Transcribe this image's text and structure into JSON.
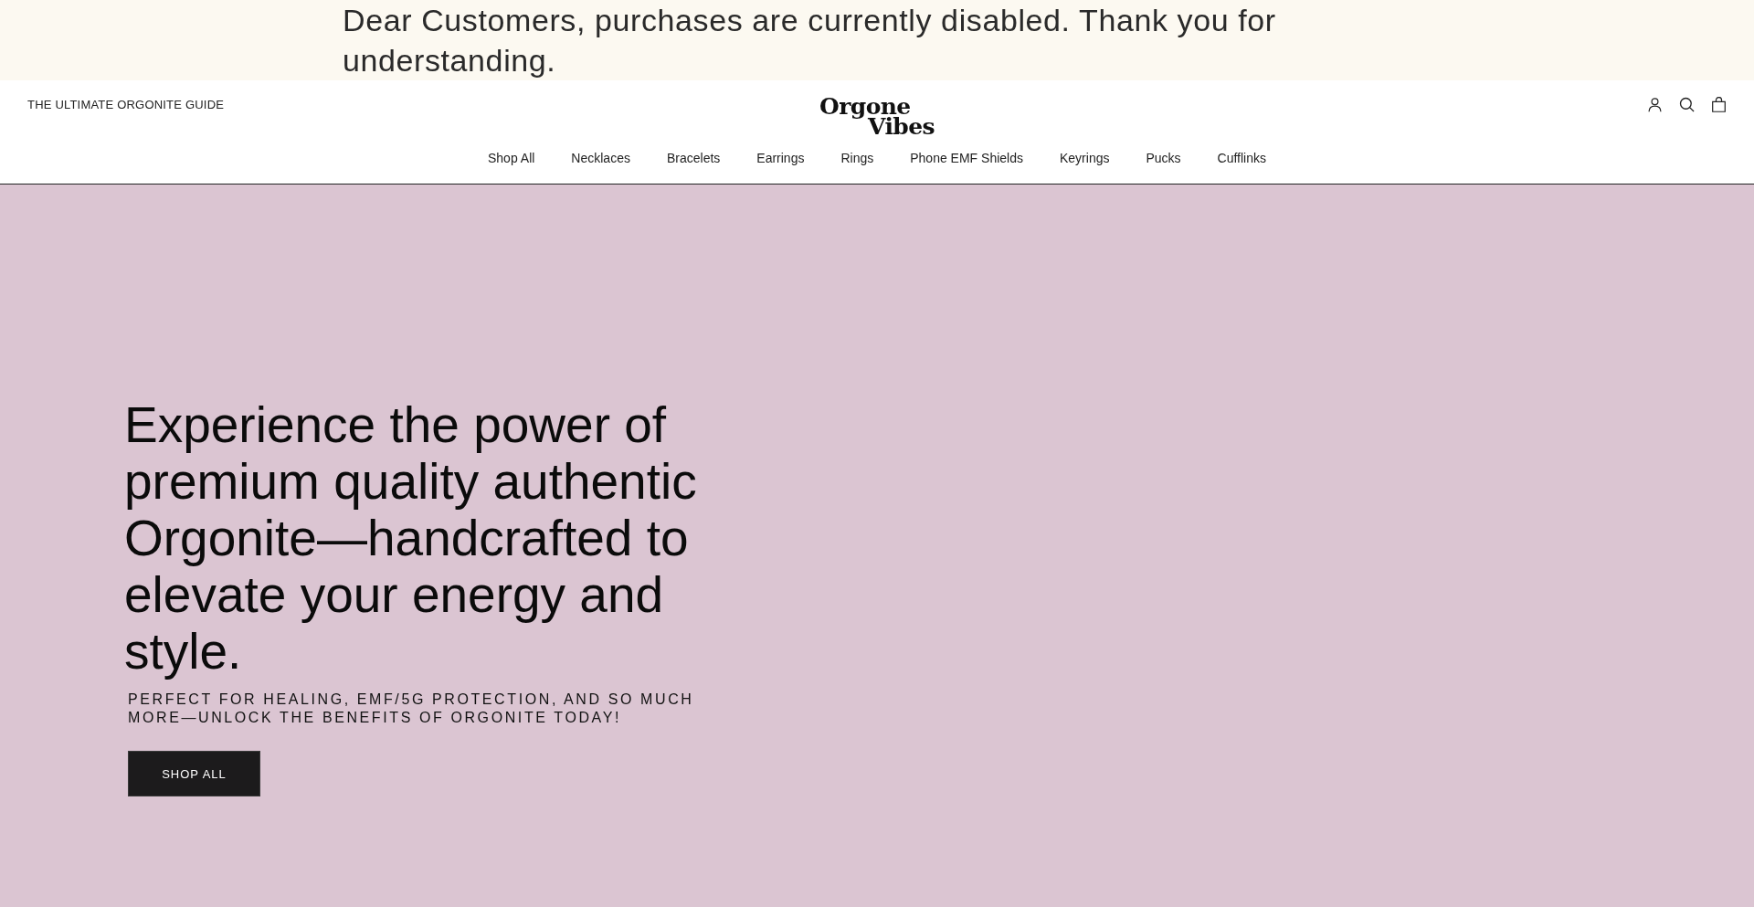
{
  "announcement": {
    "text": "Dear Customers, purchases are currently disabled. Thank you for understanding."
  },
  "header": {
    "guide_link": "THE ULTIMATE ORGONITE GUIDE",
    "logo_lines": [
      "Orgone",
      "Vibes"
    ]
  },
  "nav": [
    "Shop All",
    "Necklaces",
    "Bracelets",
    "Earrings",
    "Rings",
    "Phone EMF Shields",
    "Keyrings",
    "Pucks",
    "Cufflinks"
  ],
  "hero": {
    "heading": "Experience the power of premium quality authentic Orgonite—handcrafted to elevate your energy and style.",
    "subheading": "PERFECT FOR HEALING, EMF/5G PROTECTION, AND SO MUCH MORE—UNLOCK THE BENEFITS OF ORGONITE TODAY!",
    "button": "SHOP ALL"
  }
}
